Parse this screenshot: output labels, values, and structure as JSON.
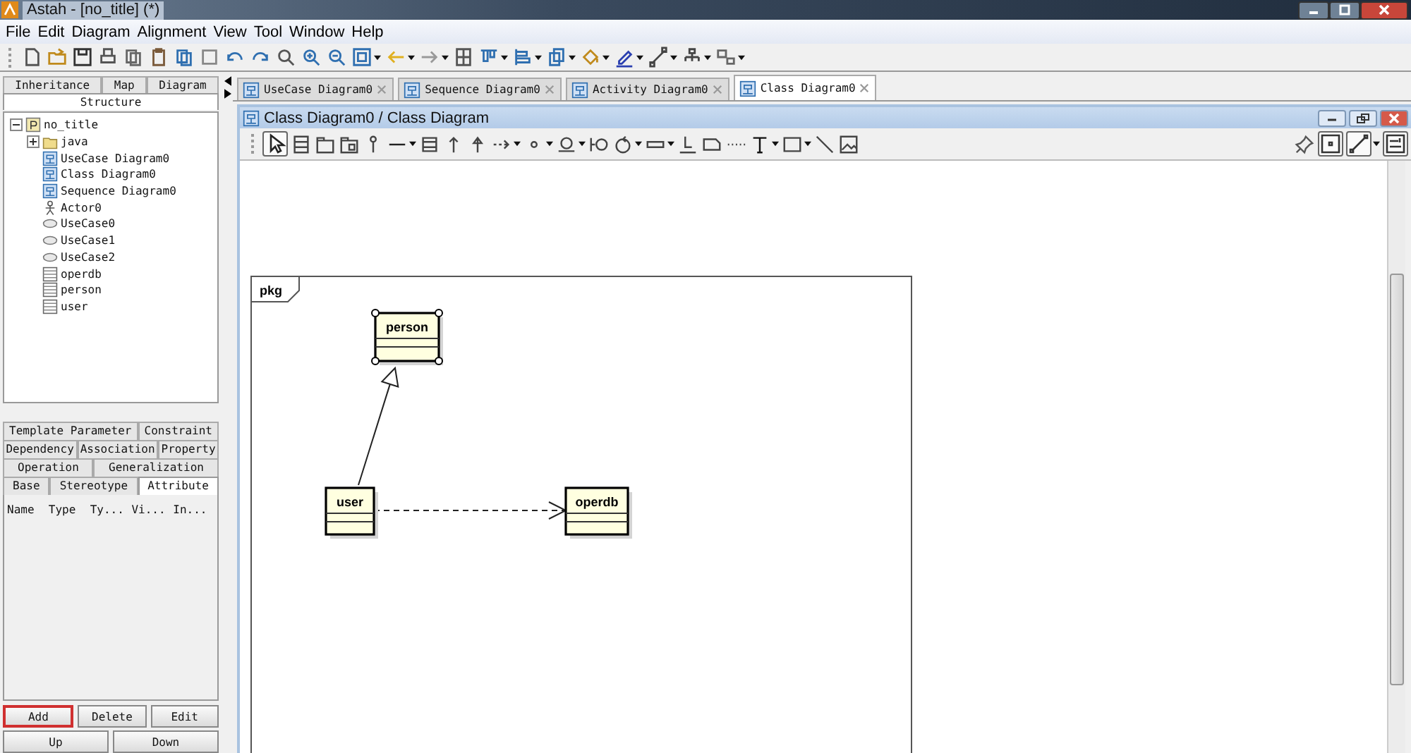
{
  "window": {
    "title": "Astah - [no_title] (*)"
  },
  "menu": [
    "File",
    "Edit",
    "Diagram",
    "Alignment",
    "View",
    "Tool",
    "Window",
    "Help"
  ],
  "navigator": {
    "tab_rows": [
      [
        {
          "label": "Inheritance",
          "selected": false
        },
        {
          "label": "Map",
          "selected": false
        },
        {
          "label": "Diagram",
          "selected": false
        }
      ],
      [
        {
          "label": "Structure",
          "selected": true
        }
      ]
    ],
    "tree": [
      {
        "label": "no_title",
        "kind": "project",
        "expanded": true,
        "children": [
          {
            "label": "java",
            "kind": "package",
            "expanded": false
          },
          {
            "label": "UseCase Diagram0",
            "kind": "usecase-diagram"
          },
          {
            "label": "Class Diagram0",
            "kind": "class-diagram"
          },
          {
            "label": "Sequence Diagram0",
            "kind": "sequence-diagram"
          },
          {
            "label": "Actor0",
            "kind": "actor"
          },
          {
            "label": "UseCase0",
            "kind": "usecase"
          },
          {
            "label": "UseCase1",
            "kind": "usecase"
          },
          {
            "label": "UseCase2",
            "kind": "usecase"
          },
          {
            "label": "operdb",
            "kind": "class"
          },
          {
            "label": "person",
            "kind": "class"
          },
          {
            "label": "user",
            "kind": "class"
          }
        ]
      }
    ]
  },
  "properties": {
    "tab_rows": [
      [
        {
          "label": "Template Parameter",
          "selected": false
        },
        {
          "label": "Constraint",
          "selected": false
        }
      ],
      [
        {
          "label": "Dependency",
          "selected": false
        },
        {
          "label": "Association",
          "selected": false
        },
        {
          "label": "Property",
          "selected": false
        }
      ],
      [
        {
          "label": "Operation",
          "selected": false
        },
        {
          "label": "Generalization",
          "selected": false
        }
      ],
      [
        {
          "label": "Base",
          "selected": false
        },
        {
          "label": "Stereotype",
          "selected": false
        },
        {
          "label": "Attribute",
          "selected": true
        }
      ]
    ],
    "columns": [
      "Name",
      "Type",
      "Ty...",
      "Vi...",
      "In..."
    ],
    "buttons": [
      {
        "label": "Add",
        "highlighted": true
      },
      {
        "label": "Delete",
        "highlighted": false
      },
      {
        "label": "Edit",
        "highlighted": false
      }
    ],
    "buttons_row_2": [
      "Up",
      "Down"
    ]
  },
  "documents": {
    "tabs": [
      {
        "label": "UseCase Diagram0",
        "selected": false
      },
      {
        "label": "Sequence Diagram0",
        "selected": false
      },
      {
        "label": "Activity Diagram0",
        "selected": false
      },
      {
        "label": "Class Diagram0",
        "selected": true
      }
    ]
  },
  "diagram_window": {
    "title": "Class Diagram0 / Class Diagram"
  },
  "diagram": {
    "package": "pkg",
    "classes": [
      {
        "name": "person",
        "selected": true
      },
      {
        "name": "user",
        "selected": false
      },
      {
        "name": "operdb",
        "selected": false
      }
    ],
    "relations": [
      {
        "kind": "generalization"
      },
      {
        "kind": "dependency"
      }
    ]
  }
}
